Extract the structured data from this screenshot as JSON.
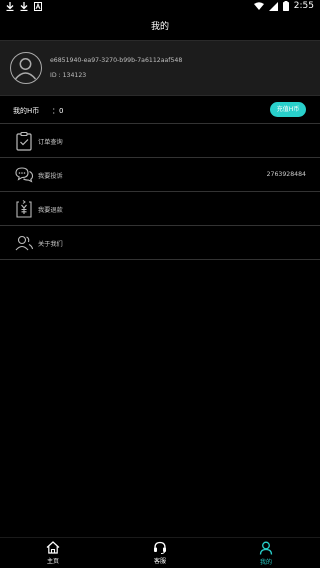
{
  "status_bar": {
    "time": "2:55"
  },
  "header": {
    "title": "我的"
  },
  "profile": {
    "user_uuid": "e6851940-ea97-3270-b99b-7a6112aaf548",
    "user_id": "ID : 134123"
  },
  "coins": {
    "label": "我的H币",
    "separator_value": "：0",
    "recharge_label": "充值H币"
  },
  "menu": {
    "items": [
      {
        "label": "订单查询",
        "extra": "",
        "icon": "clipboard-check-icon"
      },
      {
        "label": "我要投诉",
        "extra": "2763928484",
        "icon": "chat-bubbles-icon"
      },
      {
        "label": "我要退款",
        "extra": "",
        "icon": "refund-yen-icon"
      },
      {
        "label": "关于我们",
        "extra": "",
        "icon": "users-icon"
      }
    ]
  },
  "bottom_nav": {
    "items": [
      {
        "label": "主页",
        "icon": "home-icon",
        "active": false
      },
      {
        "label": "客服",
        "icon": "headset-icon",
        "active": false
      },
      {
        "label": "我的",
        "icon": "person-icon",
        "active": true
      }
    ]
  },
  "colors": {
    "accent": "#29d0cb",
    "background": "#000000",
    "card": "#1c1c1c"
  }
}
